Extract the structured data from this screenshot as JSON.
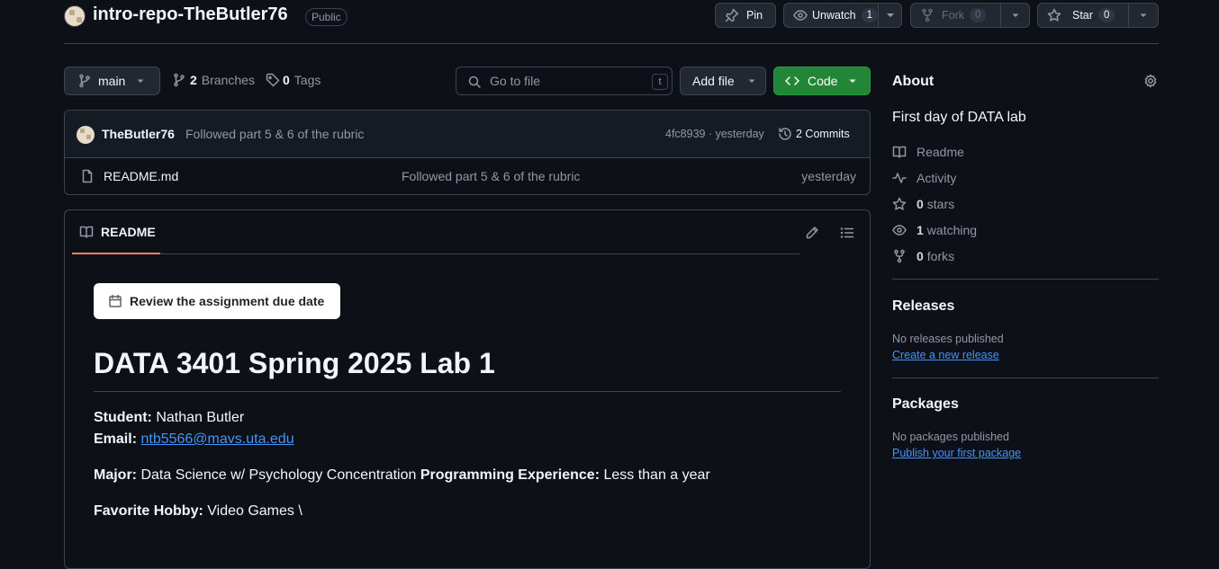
{
  "repo": {
    "name": "intro-repo-TheButler76",
    "visibility": "Public"
  },
  "header_actions": {
    "pin": "Pin",
    "unwatch": "Unwatch",
    "watch_count": "1",
    "fork": "Fork",
    "fork_count": "0",
    "star": "Star",
    "star_count": "0"
  },
  "toolbar": {
    "branch": "main",
    "branches_count": "2",
    "branches_label": "Branches",
    "tags_count": "0",
    "tags_label": "Tags",
    "go_to_file_placeholder": "Go to file",
    "go_to_file_shortcut": "t",
    "add_file": "Add file",
    "code": "Code"
  },
  "latest_commit": {
    "author": "TheButler76",
    "message": "Followed part 5 & 6 of the rubric",
    "hash_time": "4fc8939 · yesterday",
    "commits_label": "2 Commits"
  },
  "files": [
    {
      "name": "README.md",
      "message": "Followed part 5 & 6 of the rubric",
      "time": "yesterday"
    }
  ],
  "readme": {
    "tab": "README",
    "due_date_button": "Review the assignment due date",
    "heading": "DATA 3401 Spring 2025 Lab 1",
    "student_label": "Student:",
    "student_value": "Nathan Butler",
    "email_label": "Email:",
    "email_value": "ntb5566@mavs.uta.edu",
    "major_label": "Major:",
    "major_value": "Data Science w/ Psychology Concentration",
    "experience_label": "Programming Experience:",
    "experience_value": "Less than a year",
    "hobby_label": "Favorite Hobby:",
    "hobby_value": "Video Games \\"
  },
  "about": {
    "title": "About",
    "description": "First day of DATA lab",
    "readme": "Readme",
    "activity": "Activity",
    "stars_count": "0",
    "stars_label": "stars",
    "watching_count": "1",
    "watching_label": "watching",
    "forks_count": "0",
    "forks_label": "forks"
  },
  "releases": {
    "title": "Releases",
    "text": "No releases published",
    "link": "Create a new release"
  },
  "packages": {
    "title": "Packages",
    "text": "No packages published",
    "link": "Publish your first package"
  },
  "colors": {
    "background": "#0d1117",
    "code_button": "#238636",
    "link": "#4493f8",
    "tab_underline": "#f78166"
  }
}
